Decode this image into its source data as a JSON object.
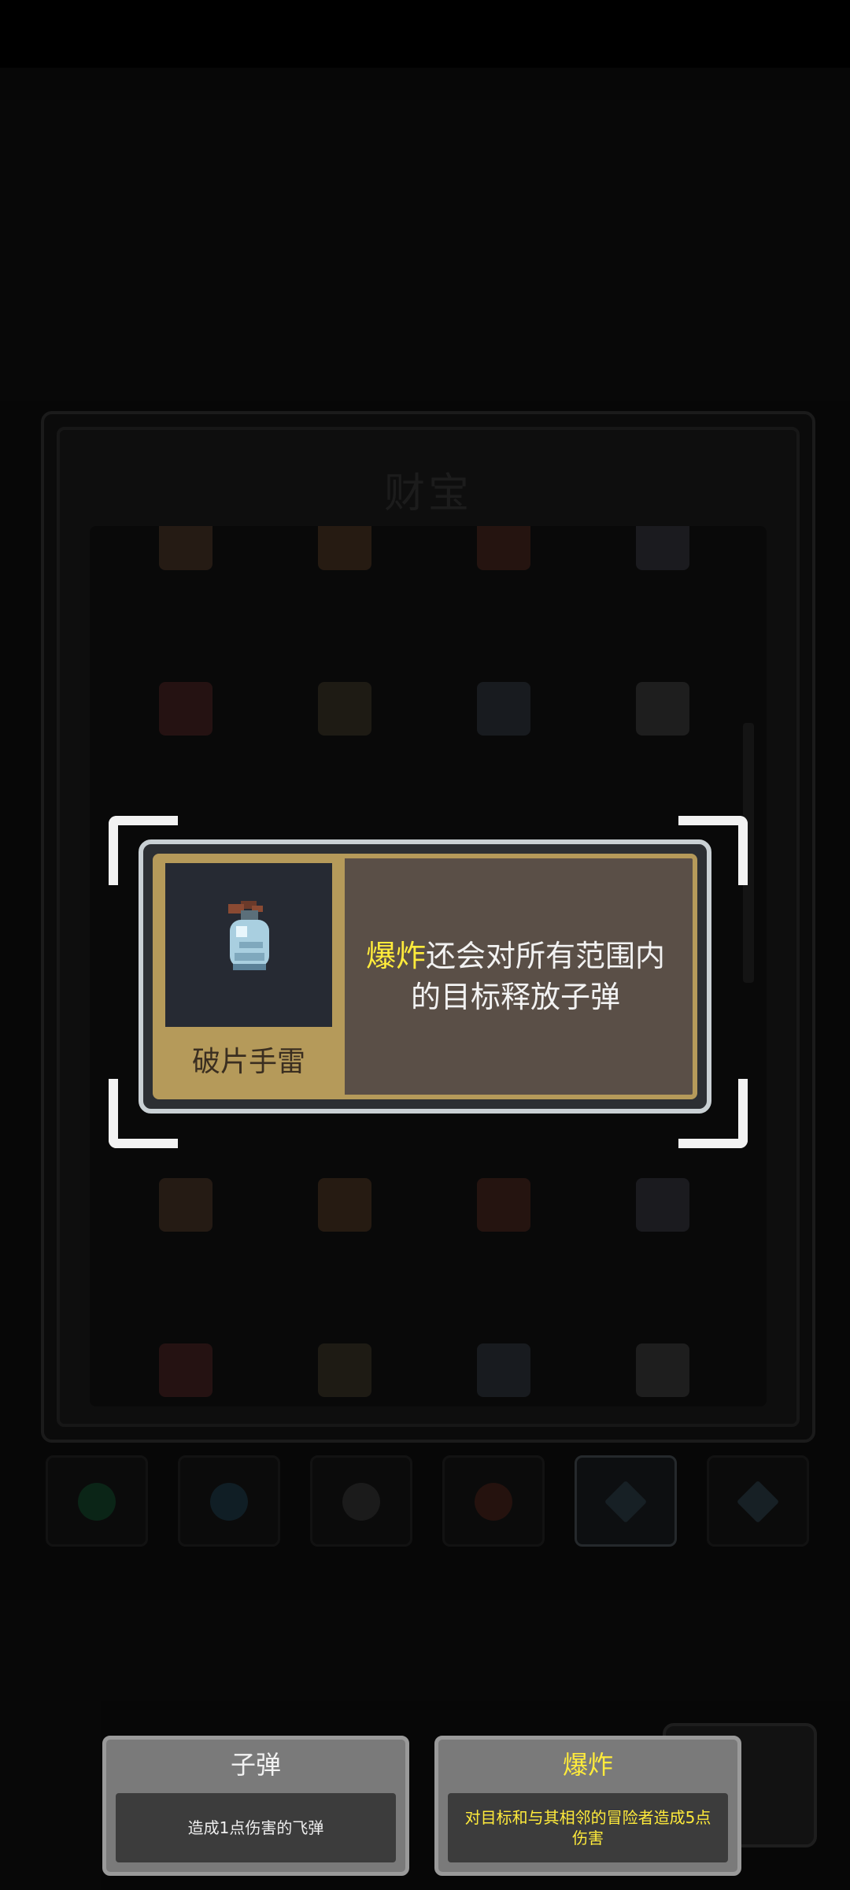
{
  "panel": {
    "title": "财宝"
  },
  "grid_icons": [
    "scroll-icon",
    "bag-icon",
    "chest-icon",
    "helmet-icon",
    "flower-icon",
    "potion-icon",
    "phone-icon",
    "egg-icon",
    "arch-icon",
    "chain-icon",
    "map-icon",
    "sack-icon",
    "crate-icon",
    "house-icon",
    "shield-lion-icon",
    "key-icon"
  ],
  "tabs": [
    {
      "icon": "clover-icon"
    },
    {
      "icon": "flask-icon"
    },
    {
      "icon": "ring-icon"
    },
    {
      "icon": "fox-icon"
    },
    {
      "icon": "gem-icon",
      "active": true
    },
    {
      "icon": "gem-icon"
    }
  ],
  "item_card": {
    "name": "破片手雷",
    "icon": "grenade-icon",
    "desc_keyword": "爆炸",
    "desc_rest": "还会对所有范围内的目标释放子弹"
  },
  "tooltips": {
    "left": {
      "title": "子弹",
      "body": "造成1点伤害的飞弹"
    },
    "right": {
      "title": "爆炸",
      "body": "对目标和与其相邻的冒险者造成5点伤害"
    }
  },
  "colors": {
    "keyword": "#ffeb3b",
    "card_border": "#c9d0d4",
    "card_gold": "#b59a5a",
    "card_bg": "#5a4f47"
  }
}
